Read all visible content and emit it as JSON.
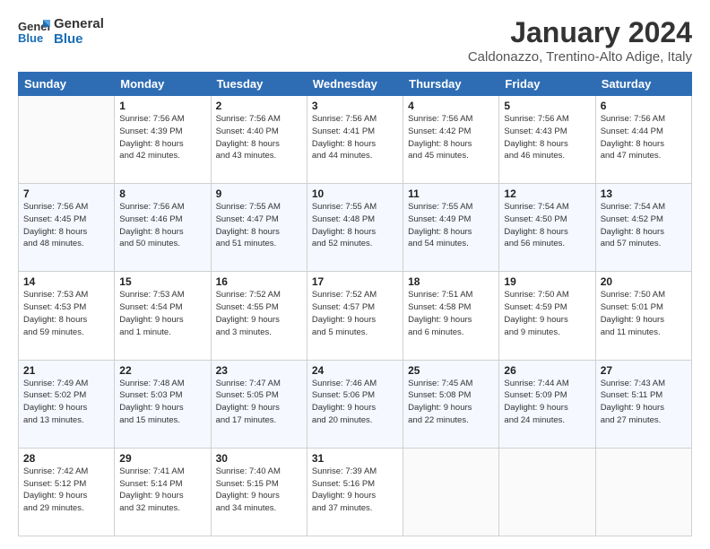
{
  "logo": {
    "line1": "General",
    "line2": "Blue"
  },
  "title": "January 2024",
  "subtitle": "Caldonazzo, Trentino-Alto Adige, Italy",
  "weekdays": [
    "Sunday",
    "Monday",
    "Tuesday",
    "Wednesday",
    "Thursday",
    "Friday",
    "Saturday"
  ],
  "weeks": [
    [
      {
        "day": "",
        "info": ""
      },
      {
        "day": "1",
        "info": "Sunrise: 7:56 AM\nSunset: 4:39 PM\nDaylight: 8 hours\nand 42 minutes."
      },
      {
        "day": "2",
        "info": "Sunrise: 7:56 AM\nSunset: 4:40 PM\nDaylight: 8 hours\nand 43 minutes."
      },
      {
        "day": "3",
        "info": "Sunrise: 7:56 AM\nSunset: 4:41 PM\nDaylight: 8 hours\nand 44 minutes."
      },
      {
        "day": "4",
        "info": "Sunrise: 7:56 AM\nSunset: 4:42 PM\nDaylight: 8 hours\nand 45 minutes."
      },
      {
        "day": "5",
        "info": "Sunrise: 7:56 AM\nSunset: 4:43 PM\nDaylight: 8 hours\nand 46 minutes."
      },
      {
        "day": "6",
        "info": "Sunrise: 7:56 AM\nSunset: 4:44 PM\nDaylight: 8 hours\nand 47 minutes."
      }
    ],
    [
      {
        "day": "7",
        "info": "Sunrise: 7:56 AM\nSunset: 4:45 PM\nDaylight: 8 hours\nand 48 minutes."
      },
      {
        "day": "8",
        "info": "Sunrise: 7:56 AM\nSunset: 4:46 PM\nDaylight: 8 hours\nand 50 minutes."
      },
      {
        "day": "9",
        "info": "Sunrise: 7:55 AM\nSunset: 4:47 PM\nDaylight: 8 hours\nand 51 minutes."
      },
      {
        "day": "10",
        "info": "Sunrise: 7:55 AM\nSunset: 4:48 PM\nDaylight: 8 hours\nand 52 minutes."
      },
      {
        "day": "11",
        "info": "Sunrise: 7:55 AM\nSunset: 4:49 PM\nDaylight: 8 hours\nand 54 minutes."
      },
      {
        "day": "12",
        "info": "Sunrise: 7:54 AM\nSunset: 4:50 PM\nDaylight: 8 hours\nand 56 minutes."
      },
      {
        "day": "13",
        "info": "Sunrise: 7:54 AM\nSunset: 4:52 PM\nDaylight: 8 hours\nand 57 minutes."
      }
    ],
    [
      {
        "day": "14",
        "info": "Sunrise: 7:53 AM\nSunset: 4:53 PM\nDaylight: 8 hours\nand 59 minutes."
      },
      {
        "day": "15",
        "info": "Sunrise: 7:53 AM\nSunset: 4:54 PM\nDaylight: 9 hours\nand 1 minute."
      },
      {
        "day": "16",
        "info": "Sunrise: 7:52 AM\nSunset: 4:55 PM\nDaylight: 9 hours\nand 3 minutes."
      },
      {
        "day": "17",
        "info": "Sunrise: 7:52 AM\nSunset: 4:57 PM\nDaylight: 9 hours\nand 5 minutes."
      },
      {
        "day": "18",
        "info": "Sunrise: 7:51 AM\nSunset: 4:58 PM\nDaylight: 9 hours\nand 6 minutes."
      },
      {
        "day": "19",
        "info": "Sunrise: 7:50 AM\nSunset: 4:59 PM\nDaylight: 9 hours\nand 9 minutes."
      },
      {
        "day": "20",
        "info": "Sunrise: 7:50 AM\nSunset: 5:01 PM\nDaylight: 9 hours\nand 11 minutes."
      }
    ],
    [
      {
        "day": "21",
        "info": "Sunrise: 7:49 AM\nSunset: 5:02 PM\nDaylight: 9 hours\nand 13 minutes."
      },
      {
        "day": "22",
        "info": "Sunrise: 7:48 AM\nSunset: 5:03 PM\nDaylight: 9 hours\nand 15 minutes."
      },
      {
        "day": "23",
        "info": "Sunrise: 7:47 AM\nSunset: 5:05 PM\nDaylight: 9 hours\nand 17 minutes."
      },
      {
        "day": "24",
        "info": "Sunrise: 7:46 AM\nSunset: 5:06 PM\nDaylight: 9 hours\nand 20 minutes."
      },
      {
        "day": "25",
        "info": "Sunrise: 7:45 AM\nSunset: 5:08 PM\nDaylight: 9 hours\nand 22 minutes."
      },
      {
        "day": "26",
        "info": "Sunrise: 7:44 AM\nSunset: 5:09 PM\nDaylight: 9 hours\nand 24 minutes."
      },
      {
        "day": "27",
        "info": "Sunrise: 7:43 AM\nSunset: 5:11 PM\nDaylight: 9 hours\nand 27 minutes."
      }
    ],
    [
      {
        "day": "28",
        "info": "Sunrise: 7:42 AM\nSunset: 5:12 PM\nDaylight: 9 hours\nand 29 minutes."
      },
      {
        "day": "29",
        "info": "Sunrise: 7:41 AM\nSunset: 5:14 PM\nDaylight: 9 hours\nand 32 minutes."
      },
      {
        "day": "30",
        "info": "Sunrise: 7:40 AM\nSunset: 5:15 PM\nDaylight: 9 hours\nand 34 minutes."
      },
      {
        "day": "31",
        "info": "Sunrise: 7:39 AM\nSunset: 5:16 PM\nDaylight: 9 hours\nand 37 minutes."
      },
      {
        "day": "",
        "info": ""
      },
      {
        "day": "",
        "info": ""
      },
      {
        "day": "",
        "info": ""
      }
    ]
  ]
}
